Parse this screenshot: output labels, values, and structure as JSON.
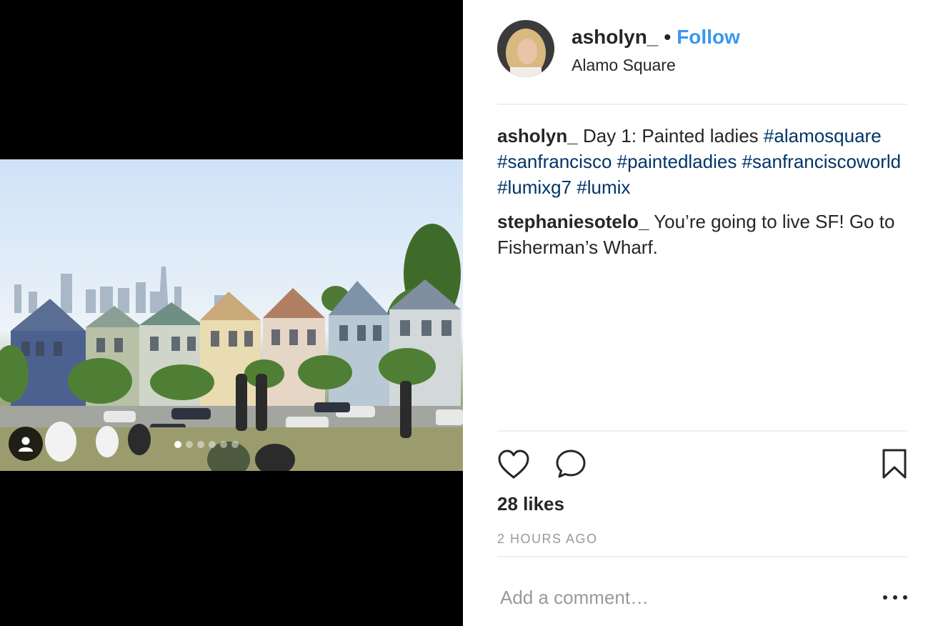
{
  "post": {
    "username": "asholyn_",
    "separator": "•",
    "follow_label": "Follow",
    "location": "Alamo Square",
    "image_alt": "Painted Ladies houses at Alamo Square, San Francisco",
    "carousel": {
      "count": 6,
      "active_index": 0
    }
  },
  "comments": [
    {
      "user": "asholyn_",
      "text": "Day 1: Painted ladies",
      "hashtags": "#alamosquare #sanfrancisco #paintedladies #sanfranciscoworld #lumixg7 #lumix"
    },
    {
      "user": "stephaniesotelo_",
      "text": "You’re going to live SF! Go to Fisherman’s Wharf."
    }
  ],
  "actions": {
    "like_icon": "heart-icon",
    "comment_icon": "speech-bubble-icon",
    "save_icon": "bookmark-icon"
  },
  "likes": "28 likes",
  "time": "2 HOURS AGO",
  "comment_box": {
    "placeholder": "Add a comment…",
    "value": ""
  },
  "colors": {
    "link": "#3897f0",
    "hashtag": "#003569",
    "muted": "#999999"
  }
}
